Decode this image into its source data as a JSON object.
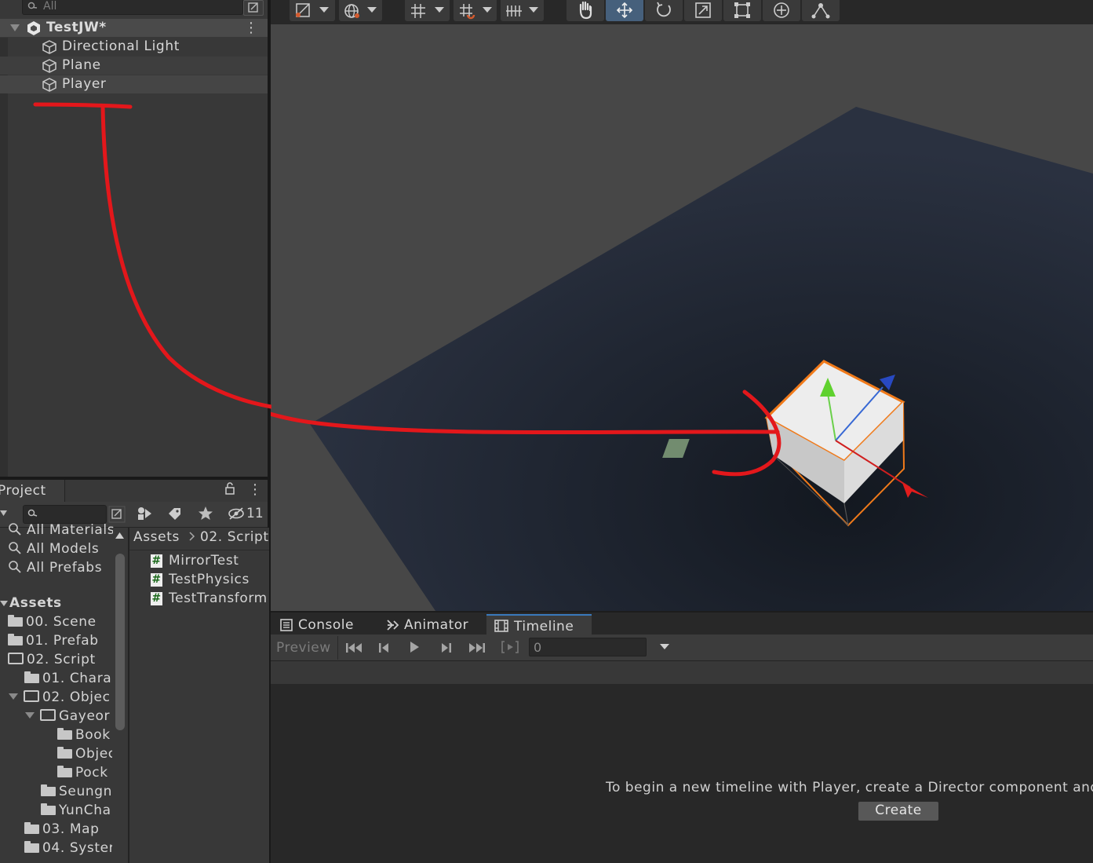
{
  "hierarchy": {
    "search_placeholder": "All",
    "scene_name": "TestJW*",
    "items": [
      {
        "label": "Directional Light",
        "icon": "cube-icon"
      },
      {
        "label": "Plane",
        "icon": "cube-icon"
      },
      {
        "label": "Player",
        "icon": "cube-icon"
      }
    ]
  },
  "project": {
    "tab_label": "Project",
    "hidden_count": "11",
    "favorites": [
      "All Materials",
      "All Models",
      "All Prefabs"
    ],
    "assets_label": "Assets",
    "tree": [
      {
        "label": "00. Scene",
        "level": 0,
        "open": false
      },
      {
        "label": "01. Prefab",
        "level": 0,
        "open": false
      },
      {
        "label": "02. Script",
        "level": 0,
        "open": true
      },
      {
        "label": "01. Chara",
        "level": 1,
        "open": false
      },
      {
        "label": "02. Objec",
        "level": 1,
        "open": true
      },
      {
        "label": "Gayeor",
        "level": 2,
        "open": true
      },
      {
        "label": "Book",
        "level": 3,
        "open": false
      },
      {
        "label": "Objec",
        "level": 3,
        "open": false
      },
      {
        "label": "Pock",
        "level": 3,
        "open": false
      },
      {
        "label": "Seungn",
        "level": 2,
        "open": false
      },
      {
        "label": "YunCha",
        "level": 2,
        "open": false
      },
      {
        "label": "03. Map",
        "level": 1,
        "open": false
      },
      {
        "label": "04. Syster",
        "level": 1,
        "open": false
      }
    ],
    "breadcrumb": [
      "Assets",
      "02. Script"
    ],
    "files": [
      "MirrorTest",
      "TestPhysics",
      "TestTransform"
    ]
  },
  "bottom": {
    "tabs": [
      {
        "label": "Console",
        "icon": "console-icon"
      },
      {
        "label": "Animator",
        "icon": "animator-icon"
      },
      {
        "label": "Timeline",
        "icon": "timeline-icon"
      }
    ],
    "preview_label": "Preview",
    "frame_value": "0",
    "message": "To begin a new timeline with Player, create a Director component and a",
    "create_label": "Create"
  },
  "colors": {
    "accent": "#3a79bb",
    "annotation": "#e3171b",
    "selection_outline": "#f07a1a"
  }
}
